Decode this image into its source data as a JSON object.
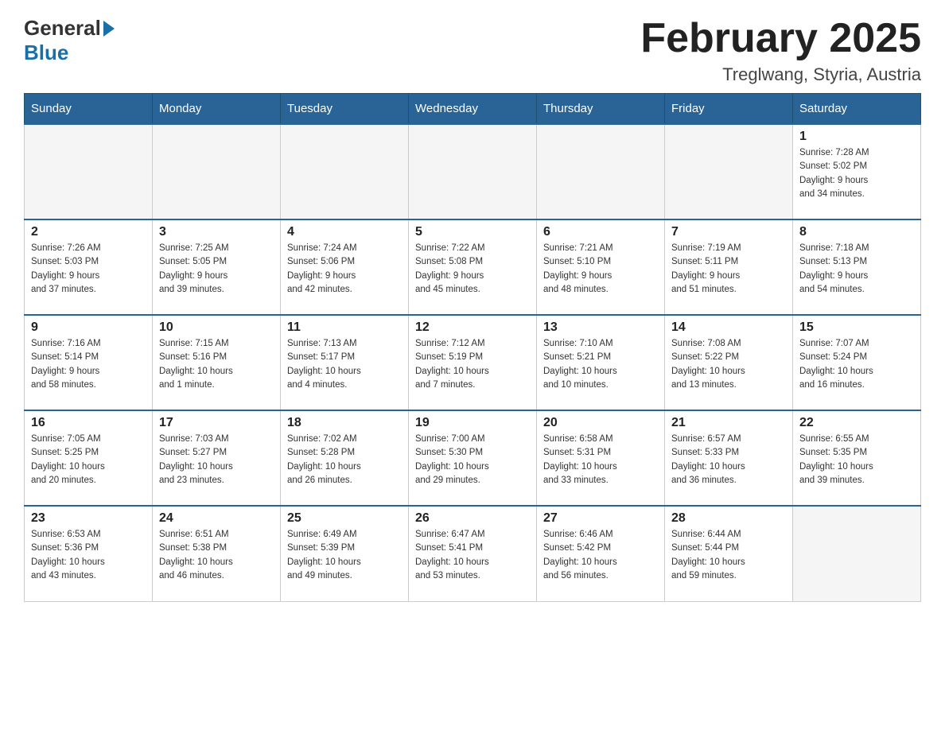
{
  "header": {
    "logo_general": "General",
    "logo_blue": "Blue",
    "month_title": "February 2025",
    "location": "Treglwang, Styria, Austria"
  },
  "weekdays": [
    "Sunday",
    "Monday",
    "Tuesday",
    "Wednesday",
    "Thursday",
    "Friday",
    "Saturday"
  ],
  "weeks": [
    [
      {
        "day": "",
        "info": ""
      },
      {
        "day": "",
        "info": ""
      },
      {
        "day": "",
        "info": ""
      },
      {
        "day": "",
        "info": ""
      },
      {
        "day": "",
        "info": ""
      },
      {
        "day": "",
        "info": ""
      },
      {
        "day": "1",
        "info": "Sunrise: 7:28 AM\nSunset: 5:02 PM\nDaylight: 9 hours\nand 34 minutes."
      }
    ],
    [
      {
        "day": "2",
        "info": "Sunrise: 7:26 AM\nSunset: 5:03 PM\nDaylight: 9 hours\nand 37 minutes."
      },
      {
        "day": "3",
        "info": "Sunrise: 7:25 AM\nSunset: 5:05 PM\nDaylight: 9 hours\nand 39 minutes."
      },
      {
        "day": "4",
        "info": "Sunrise: 7:24 AM\nSunset: 5:06 PM\nDaylight: 9 hours\nand 42 minutes."
      },
      {
        "day": "5",
        "info": "Sunrise: 7:22 AM\nSunset: 5:08 PM\nDaylight: 9 hours\nand 45 minutes."
      },
      {
        "day": "6",
        "info": "Sunrise: 7:21 AM\nSunset: 5:10 PM\nDaylight: 9 hours\nand 48 minutes."
      },
      {
        "day": "7",
        "info": "Sunrise: 7:19 AM\nSunset: 5:11 PM\nDaylight: 9 hours\nand 51 minutes."
      },
      {
        "day": "8",
        "info": "Sunrise: 7:18 AM\nSunset: 5:13 PM\nDaylight: 9 hours\nand 54 minutes."
      }
    ],
    [
      {
        "day": "9",
        "info": "Sunrise: 7:16 AM\nSunset: 5:14 PM\nDaylight: 9 hours\nand 58 minutes."
      },
      {
        "day": "10",
        "info": "Sunrise: 7:15 AM\nSunset: 5:16 PM\nDaylight: 10 hours\nand 1 minute."
      },
      {
        "day": "11",
        "info": "Sunrise: 7:13 AM\nSunset: 5:17 PM\nDaylight: 10 hours\nand 4 minutes."
      },
      {
        "day": "12",
        "info": "Sunrise: 7:12 AM\nSunset: 5:19 PM\nDaylight: 10 hours\nand 7 minutes."
      },
      {
        "day": "13",
        "info": "Sunrise: 7:10 AM\nSunset: 5:21 PM\nDaylight: 10 hours\nand 10 minutes."
      },
      {
        "day": "14",
        "info": "Sunrise: 7:08 AM\nSunset: 5:22 PM\nDaylight: 10 hours\nand 13 minutes."
      },
      {
        "day": "15",
        "info": "Sunrise: 7:07 AM\nSunset: 5:24 PM\nDaylight: 10 hours\nand 16 minutes."
      }
    ],
    [
      {
        "day": "16",
        "info": "Sunrise: 7:05 AM\nSunset: 5:25 PM\nDaylight: 10 hours\nand 20 minutes."
      },
      {
        "day": "17",
        "info": "Sunrise: 7:03 AM\nSunset: 5:27 PM\nDaylight: 10 hours\nand 23 minutes."
      },
      {
        "day": "18",
        "info": "Sunrise: 7:02 AM\nSunset: 5:28 PM\nDaylight: 10 hours\nand 26 minutes."
      },
      {
        "day": "19",
        "info": "Sunrise: 7:00 AM\nSunset: 5:30 PM\nDaylight: 10 hours\nand 29 minutes."
      },
      {
        "day": "20",
        "info": "Sunrise: 6:58 AM\nSunset: 5:31 PM\nDaylight: 10 hours\nand 33 minutes."
      },
      {
        "day": "21",
        "info": "Sunrise: 6:57 AM\nSunset: 5:33 PM\nDaylight: 10 hours\nand 36 minutes."
      },
      {
        "day": "22",
        "info": "Sunrise: 6:55 AM\nSunset: 5:35 PM\nDaylight: 10 hours\nand 39 minutes."
      }
    ],
    [
      {
        "day": "23",
        "info": "Sunrise: 6:53 AM\nSunset: 5:36 PM\nDaylight: 10 hours\nand 43 minutes."
      },
      {
        "day": "24",
        "info": "Sunrise: 6:51 AM\nSunset: 5:38 PM\nDaylight: 10 hours\nand 46 minutes."
      },
      {
        "day": "25",
        "info": "Sunrise: 6:49 AM\nSunset: 5:39 PM\nDaylight: 10 hours\nand 49 minutes."
      },
      {
        "day": "26",
        "info": "Sunrise: 6:47 AM\nSunset: 5:41 PM\nDaylight: 10 hours\nand 53 minutes."
      },
      {
        "day": "27",
        "info": "Sunrise: 6:46 AM\nSunset: 5:42 PM\nDaylight: 10 hours\nand 56 minutes."
      },
      {
        "day": "28",
        "info": "Sunrise: 6:44 AM\nSunset: 5:44 PM\nDaylight: 10 hours\nand 59 minutes."
      },
      {
        "day": "",
        "info": ""
      }
    ]
  ]
}
